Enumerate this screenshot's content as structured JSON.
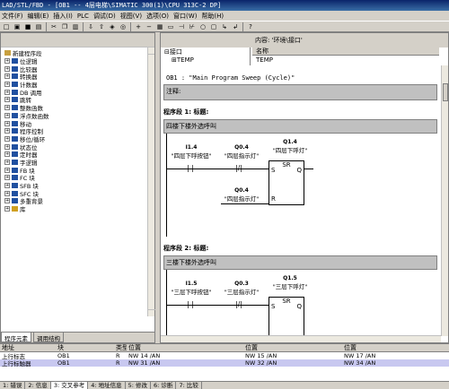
{
  "window": {
    "title": "LAD/STL/FBD  - [OB1 -- 4层电梯\\SIMATIC 300(1)\\CPU 313C-2 DP]"
  },
  "menu": [
    "文件(F)",
    "编辑(E)",
    "插入(I)",
    "PLC",
    "调试(D)",
    "视图(V)",
    "选项(O)",
    "窗口(W)",
    "帮助(H)"
  ],
  "left_panel": {
    "tree": [
      "新建程序段",
      "位逻辑",
      "比较器",
      "转换器",
      "计数器",
      "DB 调用",
      "跳转",
      "整数函数",
      "浮点数函数",
      "移动",
      "程序控制",
      "移位/循环",
      "状态位",
      "定时器",
      "字逻辑",
      "FB 块",
      "FC 块",
      "SFB 块",
      "SFC 块",
      "多重背景",
      "库"
    ],
    "tabs": [
      "程序元素",
      "调用结构"
    ]
  },
  "interface": {
    "header_left": "接口",
    "header_right": "内容: '环境\\接口'",
    "tree_root": "接口",
    "tree_child": "TEMP",
    "col_name": "名称",
    "col_item": "TEMP"
  },
  "editor": {
    "ob_title": "OB1 :  \"Main Program Sweep (Cycle)\"",
    "comment_label": "注释:",
    "networks": [
      {
        "label": "程序段 1: 标题:",
        "comment": "四楼下楼外选呼叫",
        "c1_addr": "I1.4",
        "c1_name": "\"四层下呼按钮\"",
        "c2_addr": "Q0.4",
        "c2_name": "\"四层指示灯\"",
        "c3_addr": "Q0.4",
        "c3_name": "\"四层指示灯\"",
        "coil_addr": "Q1.4",
        "coil_name": "\"四层下呼灯\""
      },
      {
        "label": "程序段 2: 标题:",
        "comment": "三楼下楼外选呼叫",
        "c1_addr": "I1.5",
        "c1_name": "\"三层下呼按钮\"",
        "c2_addr": "Q0.3",
        "c2_name": "\"三层指示灯\"",
        "c3_addr": "Q0.3",
        "c3_name": "\"三层指示灯\"",
        "coil_addr": "Q1.5",
        "coil_name": "\"三层下呼灯\""
      }
    ],
    "sr_label": "SR",
    "s_pin": "S",
    "r_pin": "R",
    "q_pin": "Q"
  },
  "bottom": {
    "headers": [
      "地址",
      "块",
      "类型",
      "位置",
      "位置",
      "位置"
    ],
    "rows": [
      {
        "addr": "上行标志",
        "block": "OB1",
        "type": "R",
        "p1": "NW   14   /AN",
        "p2": "NW   15   /AN",
        "p3": "NW   17   /AN"
      },
      {
        "addr": "上行标触器",
        "block": "OB1",
        "type": "R",
        "p1": "NW   31   /AN",
        "p2": "NW   32   /AN",
        "p3": "NW   34   /AN"
      }
    ],
    "tabs": [
      "1: 错误",
      "2: 信息",
      "3: 交叉参考",
      "4: 地址信息",
      "5: 修改",
      "6: 诊断",
      "7: 比较"
    ]
  }
}
